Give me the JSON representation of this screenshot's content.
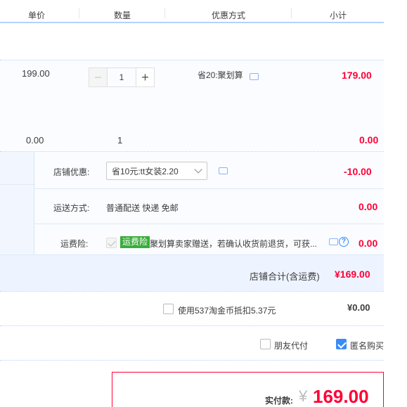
{
  "header": {
    "col_price": "单价",
    "col_qty": "数量",
    "col_discount": "优惠方式",
    "col_subtotal": "小计"
  },
  "item": {
    "unit_price": "199.00",
    "quantity": "1",
    "discount": "省20:聚划算",
    "subtotal": "179.00",
    "minus": "−",
    "plus": "+"
  },
  "gift_row": {
    "unit_price": "0.00",
    "quantity": "1",
    "subtotal": "0.00"
  },
  "shop": {
    "coupon_label": "店铺优惠:",
    "coupon_value": "省10元:tt女装2.20",
    "coupon_amount": "-10.00",
    "shipping_label": "运送方式:",
    "shipping_value": "普通配送 快递 免邮",
    "shipping_amount": "0.00",
    "insurance_label": "运费险:",
    "insurance_badge": "运费险",
    "insurance_text": "聚划算卖家赠送，若确认收货前退货，可获...",
    "insurance_help": "?",
    "insurance_amount": "0.00",
    "total_label": "店铺合计(含运费)",
    "total_value": "¥169.00"
  },
  "coins": {
    "label": "使用537淘金币抵扣5.37元",
    "amount": "¥0.00"
  },
  "options": {
    "friend_pay": "朋友代付",
    "anonymous": "匿名购买"
  },
  "payment": {
    "label": "实付款:",
    "currency": "¥",
    "amount": "169.00"
  },
  "colors": {
    "accent_red": "#ff0036",
    "accent_blue": "#3a8cf5",
    "badge_green": "#3aad3a"
  }
}
